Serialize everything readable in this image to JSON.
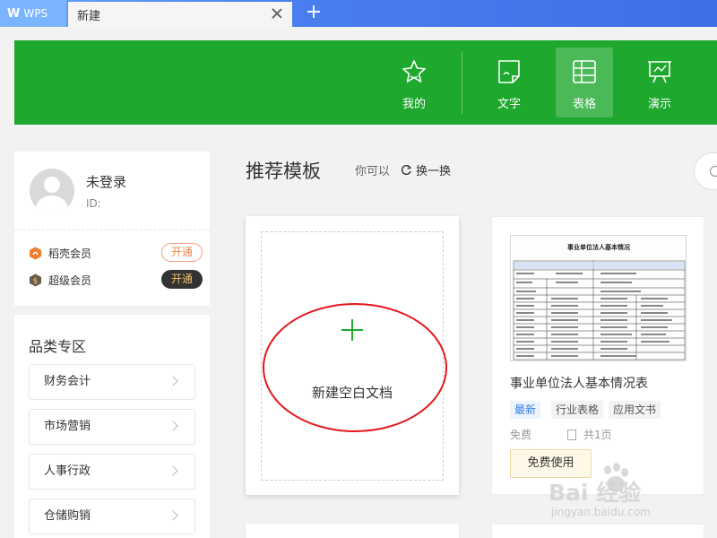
{
  "tabs": {
    "app_label": "WPS",
    "app_logo": "W",
    "doc_tab_label": "新建",
    "add_tab_icon": "plus-icon"
  },
  "header": {
    "background": "#1fa82e",
    "nav": [
      {
        "label": "我的",
        "icon": "star-icon"
      },
      {
        "label": "文字",
        "icon": "document-icon"
      },
      {
        "label": "表格",
        "icon": "table-icon",
        "active": true
      },
      {
        "label": "演示",
        "icon": "presentation-icon"
      }
    ]
  },
  "user": {
    "name": "未登录",
    "id_label": "ID:",
    "memberships": [
      {
        "label": "稻壳会员",
        "action": "开通",
        "icon": "docer-icon"
      },
      {
        "label": "超级会员",
        "action": "开通",
        "icon": "super-member-icon"
      }
    ]
  },
  "categories": {
    "title": "品类专区",
    "items": [
      "财务会计",
      "市场营销",
      "人事行政",
      "仓储购销"
    ]
  },
  "main": {
    "section_title": "推荐模板",
    "hint": "你可以",
    "refresh_label": "换一换",
    "blank_card_label": "新建空白文档",
    "template": {
      "name": "事业单位法人基本情况表",
      "thumb_title": "事业单位法人基本情况",
      "tags": [
        "最新",
        "行业表格",
        "应用文书"
      ],
      "price": "免费",
      "pages": "共1页",
      "use_button": "免费使用"
    }
  },
  "watermark": {
    "main": "Bai 经验",
    "sub": "jingyan.baidu.com"
  },
  "colors": {
    "accent_green": "#1fa82e",
    "annotation_red": "#e4161b",
    "tab_blue": "#4a7ff0"
  }
}
